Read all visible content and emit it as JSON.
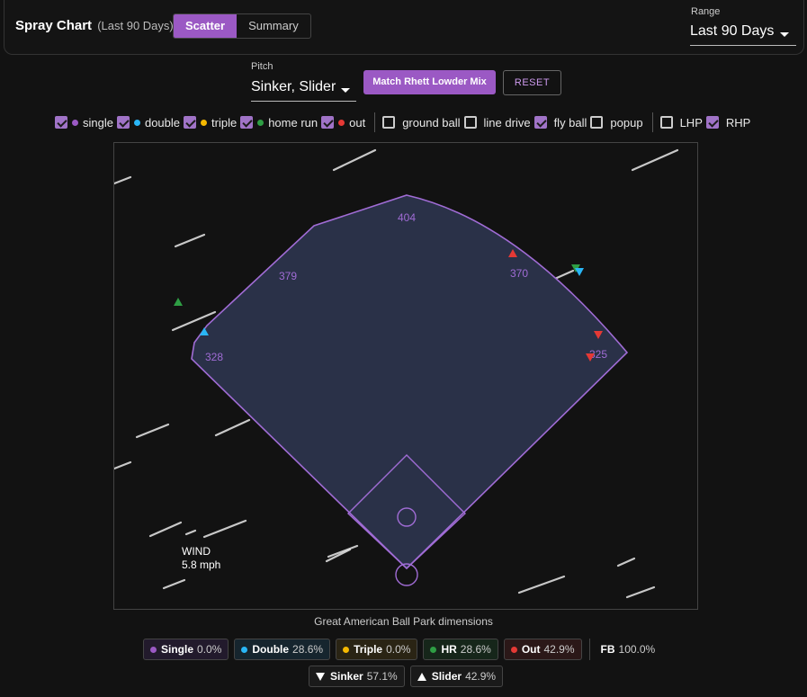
{
  "header": {
    "title": "Spray Chart",
    "subtitle": "(Last 90 Days)",
    "tabs": [
      {
        "label": "Scatter",
        "active": true
      },
      {
        "label": "Summary",
        "active": false
      }
    ],
    "range_label": "Range",
    "range_value": "Last 90 Days"
  },
  "controls": {
    "pitch_label": "Pitch",
    "pitch_value": "Sinker, Slider",
    "match_button": "Match Rhett Lowder Mix",
    "reset_button": "RESET"
  },
  "filters": {
    "outcomes": [
      {
        "label": "single",
        "checked": true,
        "color": "#9b59c4"
      },
      {
        "label": "double",
        "checked": true,
        "color": "#29b6f6"
      },
      {
        "label": "triple",
        "checked": true,
        "color": "#f5b800"
      },
      {
        "label": "home run",
        "checked": true,
        "color": "#2e9e44"
      },
      {
        "label": "out",
        "checked": true,
        "color": "#e53935"
      }
    ],
    "batted": [
      {
        "label": "ground ball",
        "checked": false
      },
      {
        "label": "line drive",
        "checked": false
      },
      {
        "label": "fly ball",
        "checked": true
      },
      {
        "label": "popup",
        "checked": false
      }
    ],
    "hand": [
      {
        "label": "LHP",
        "checked": false
      },
      {
        "label": "RHP",
        "checked": true
      }
    ]
  },
  "field": {
    "distance_labels": [
      "404",
      "379",
      "370",
      "328",
      "325"
    ],
    "wind_label": "WIND",
    "wind_speed": "5.8 mph",
    "caption": "Great American Ball Park dimensions"
  },
  "hits": [
    {
      "type": "home run",
      "marker": "up"
    },
    {
      "type": "double",
      "marker": "up"
    },
    {
      "type": "out",
      "marker": "up"
    },
    {
      "type": "home run",
      "marker": "down"
    },
    {
      "type": "double",
      "marker": "down"
    },
    {
      "type": "out",
      "marker": "down"
    },
    {
      "type": "out",
      "marker": "down"
    }
  ],
  "legend": {
    "outcomes": [
      {
        "label": "Single",
        "pct": "0.0%",
        "color": "#9b59c4",
        "bg": "#221a2c"
      },
      {
        "label": "Double",
        "pct": "28.6%",
        "color": "#29b6f6",
        "bg": "#16252e"
      },
      {
        "label": "Triple",
        "pct": "0.0%",
        "color": "#f5b800",
        "bg": "#2a2414"
      },
      {
        "label": "HR",
        "pct": "28.6%",
        "color": "#2e9e44",
        "bg": "#16261a"
      },
      {
        "label": "Out",
        "pct": "42.9%",
        "color": "#e53935",
        "bg": "#2b1818"
      }
    ],
    "fb_label": "FB",
    "fb_pct": "100.0%",
    "pitches": [
      {
        "label": "Sinker",
        "pct": "57.1%",
        "marker": "down"
      },
      {
        "label": "Slider",
        "pct": "42.9%",
        "marker": "up"
      }
    ]
  }
}
